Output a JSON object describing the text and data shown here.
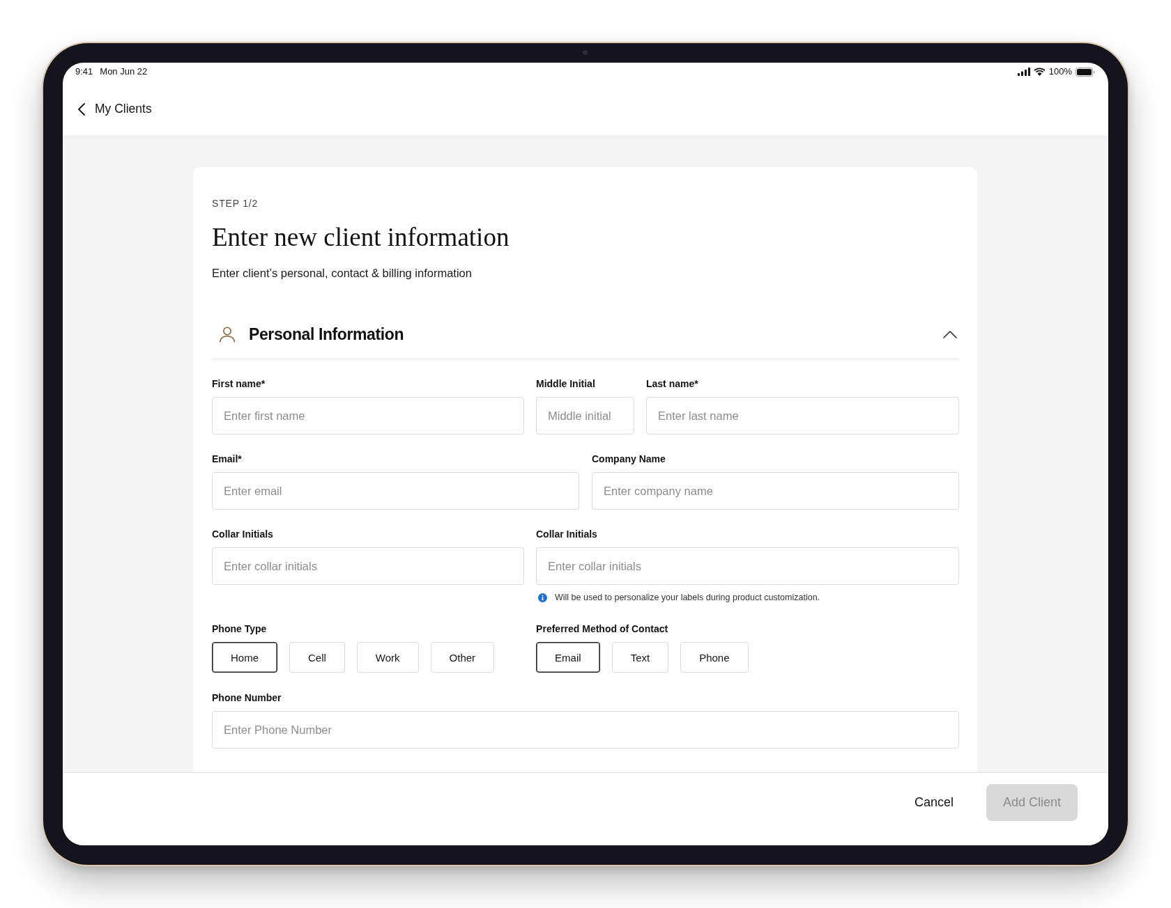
{
  "status_bar": {
    "time": "9:41",
    "date": "Mon Jun 22",
    "battery": "100%"
  },
  "navigation": {
    "back_label": "My Clients"
  },
  "form": {
    "step": "STEP 1/2",
    "title": "Enter new client information",
    "subtitle": "Enter client’s personal, contact & billing information"
  },
  "section": {
    "title": "Personal Information",
    "expanded": true,
    "field_rows": [
      {
        "fields": [
          {
            "label": "First name*",
            "placeholder": "Enter first name"
          },
          {
            "label": "Middle Initial",
            "placeholder": "Middle initial"
          },
          {
            "label": "Last name*",
            "placeholder": "Enter last name"
          }
        ]
      },
      {
        "fields": [
          {
            "label": "Email*",
            "placeholder": "Enter email"
          },
          {
            "label": "Company Name",
            "placeholder": "Enter company name"
          }
        ]
      },
      {
        "fields": [
          {
            "label": "Collar Initials",
            "placeholder": "Enter collar initials"
          },
          {
            "label": "Collar Initials",
            "placeholder": "Enter collar initials",
            "help": "Will be used to personalize your labels during product customization."
          }
        ]
      }
    ],
    "choice_groups": [
      {
        "label": "Phone Type",
        "options": [
          {
            "label": "Home",
            "selected": true
          },
          {
            "label": "Cell",
            "selected": false
          },
          {
            "label": "Work",
            "selected": false
          },
          {
            "label": "Other",
            "selected": false
          }
        ]
      },
      {
        "label": "Preferred Method of Contact",
        "options": [
          {
            "label": "Email",
            "selected": true
          },
          {
            "label": "Text",
            "selected": false
          },
          {
            "label": "Phone",
            "selected": false
          }
        ]
      }
    ],
    "phone_number": {
      "label": "Phone Number",
      "placeholder": "Enter Phone Number"
    }
  },
  "footer": {
    "cancel": "Cancel",
    "add_button": {
      "label": "Add Client",
      "disabled": true
    }
  }
}
